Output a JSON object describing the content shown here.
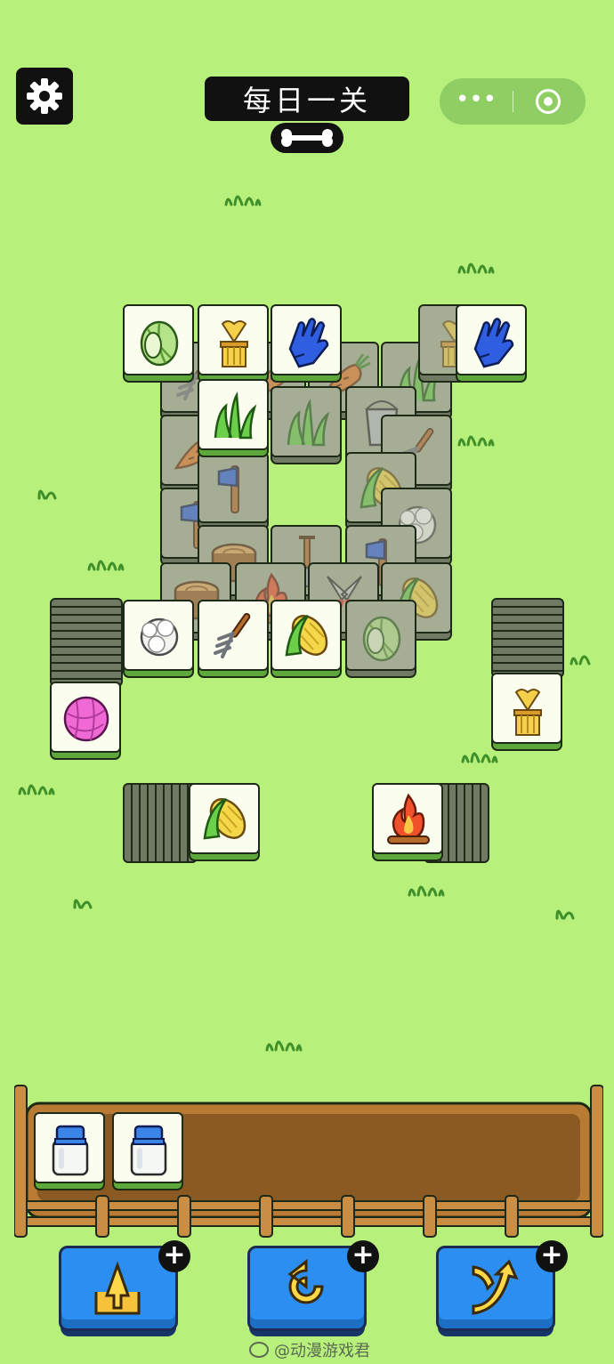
{
  "header": {
    "settings_icon": "gear-icon",
    "title": "每日一关",
    "capsule": {
      "menu": "•••",
      "close_icon": "target-icon"
    }
  },
  "tiles": {
    "types": [
      "cabbage",
      "wheat",
      "glove",
      "grass",
      "carrot",
      "axe",
      "log",
      "shovel",
      "fire",
      "shears",
      "corn",
      "wool",
      "fork",
      "yarn",
      "pail",
      "milk"
    ]
  },
  "tray": {
    "slot_count": 7,
    "items": [
      "milk",
      "milk"
    ]
  },
  "tools": [
    {
      "name": "move-out",
      "icon": "move-out-icon",
      "badge": "+"
    },
    {
      "name": "undo",
      "icon": "undo-icon",
      "badge": "+"
    },
    {
      "name": "shuffle",
      "icon": "shuffle-icon",
      "badge": "+"
    }
  ],
  "watermark": "@动漫游戏君",
  "colors": {
    "background": "#b7f07a",
    "tile_face": "#fbfdee",
    "tile_edge": "#5ea73b",
    "locked_face": "#a6ad95",
    "tool_blue": "#2b8ef0",
    "tray_wood": "#8a5a22"
  }
}
